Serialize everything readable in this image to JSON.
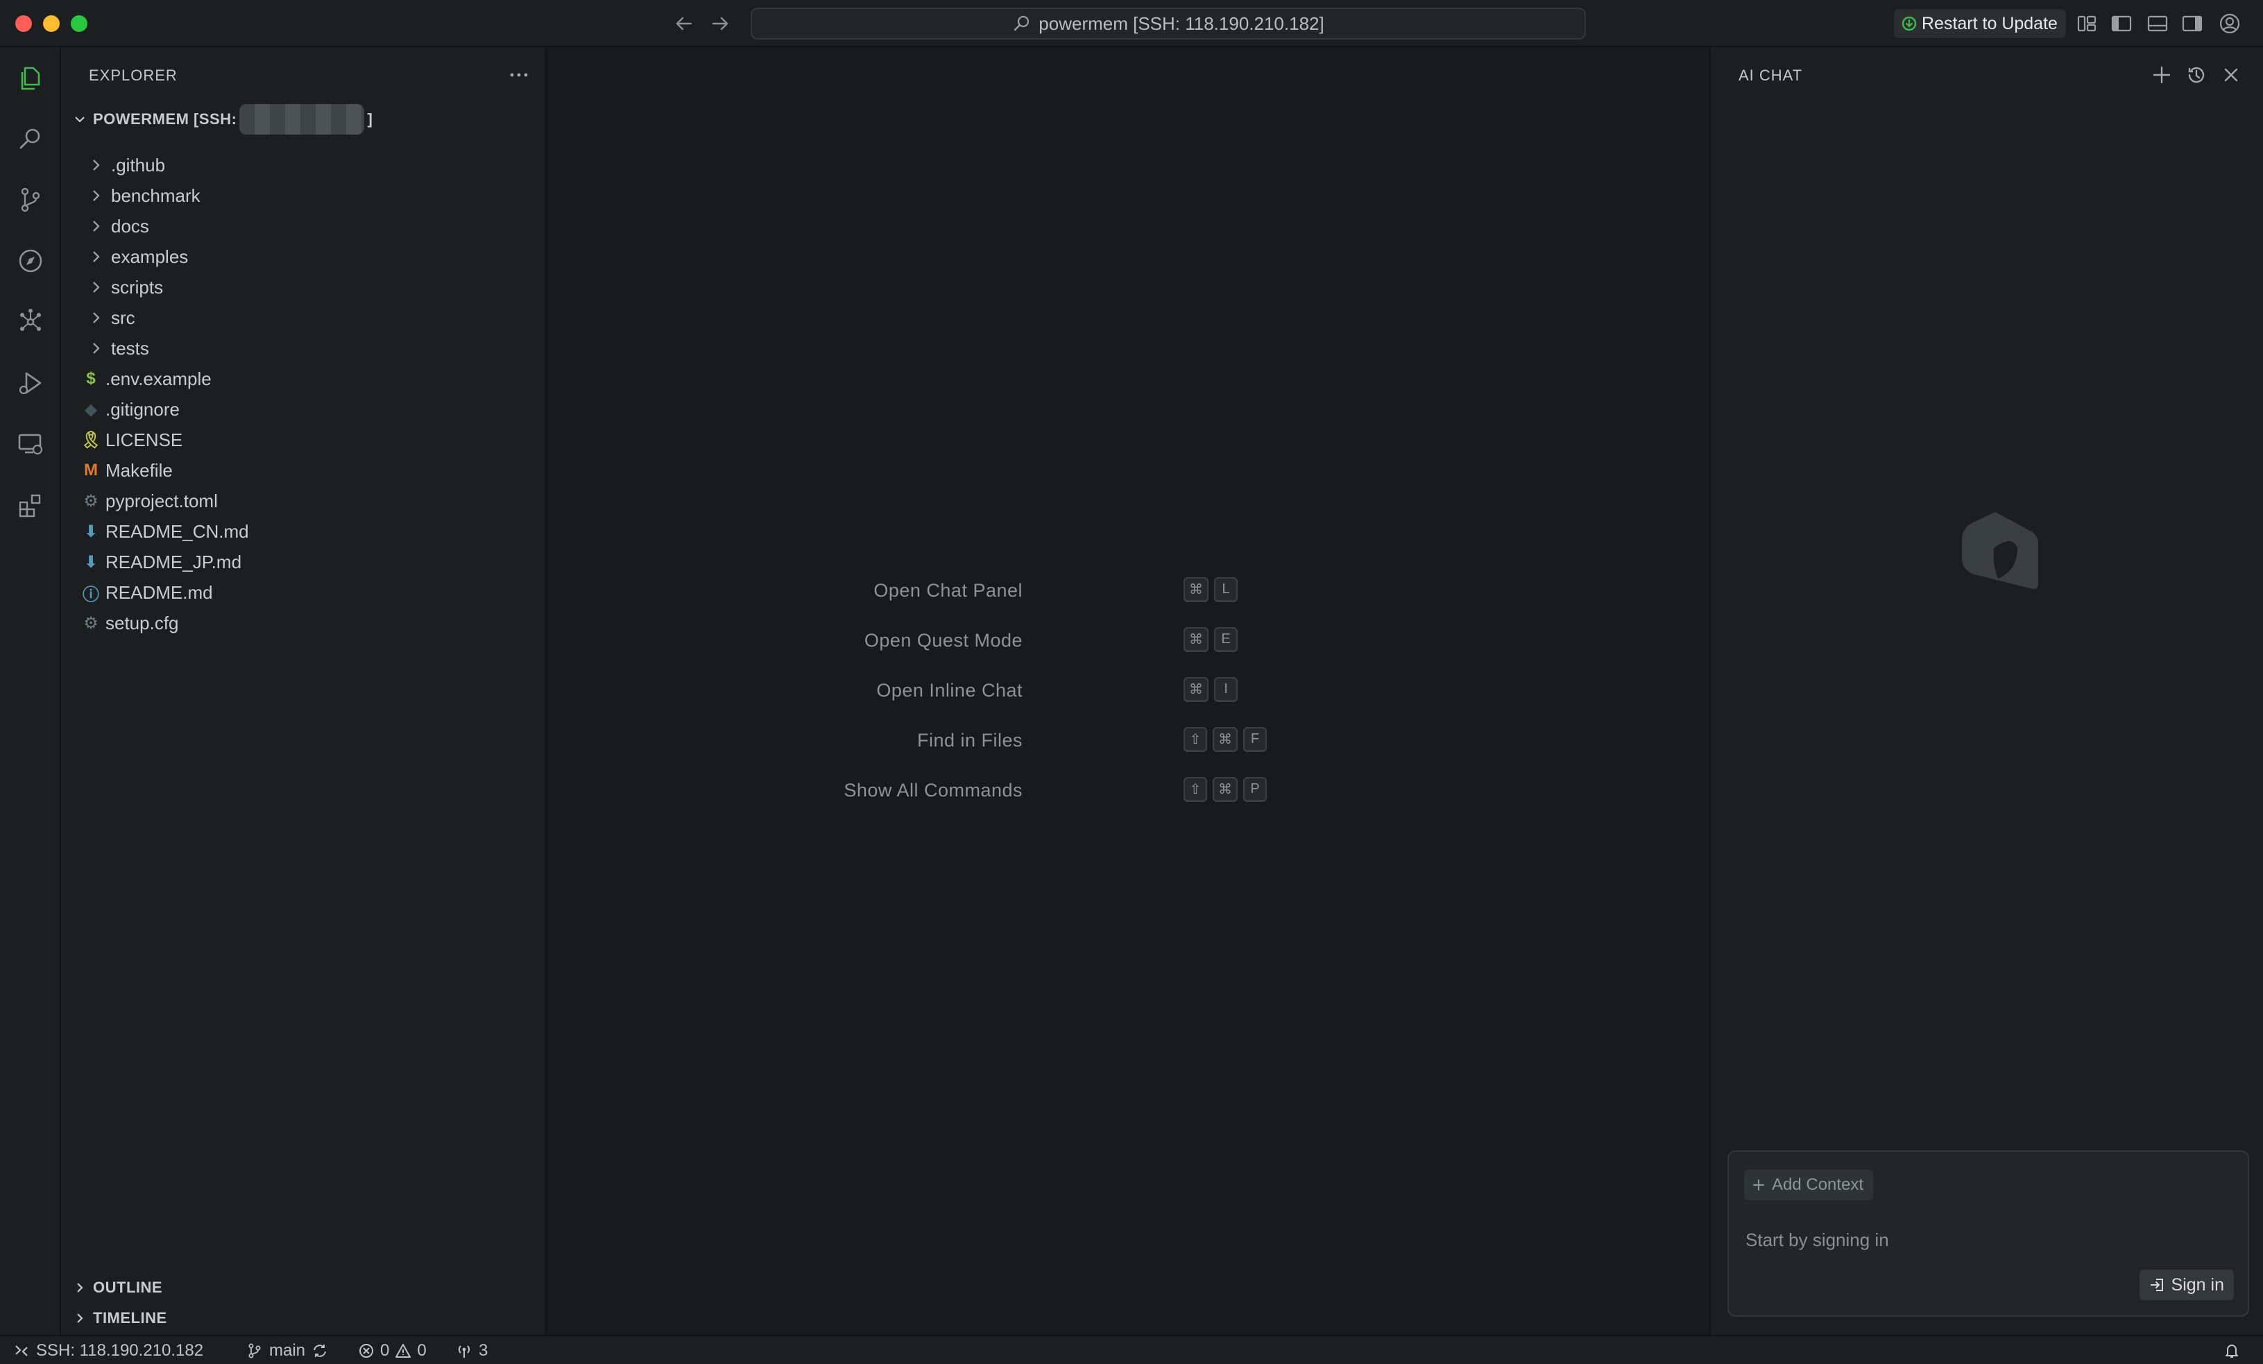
{
  "titlebar": {
    "command_center": "powermem [SSH: 118.190.210.182]",
    "restart_label": "Restart to Update",
    "colors": {
      "close": "#ff5f57",
      "minimize": "#febc2e",
      "maximize": "#28c840"
    }
  },
  "activity": [
    {
      "name": "explorer-icon",
      "active": true
    },
    {
      "name": "search-icon"
    },
    {
      "name": "source-control-icon"
    },
    {
      "name": "compass-icon"
    },
    {
      "name": "graph-icon"
    },
    {
      "name": "run-debug-icon"
    },
    {
      "name": "remote-explorer-icon"
    },
    {
      "name": "extensions-icon"
    }
  ],
  "explorer": {
    "title": "EXPLORER",
    "root_prefix": "POWERMEM [SSH:",
    "root_suffix": "]",
    "folders": [
      ".github",
      "benchmark",
      "docs",
      "examples",
      "scripts",
      "src",
      "tests"
    ],
    "files": [
      {
        "name": ".env.example",
        "icon": "$",
        "color": "#8dc149"
      },
      {
        "name": ".gitignore",
        "icon": "◆",
        "color": "#41535b"
      },
      {
        "name": "LICENSE",
        "icon": "🎗",
        "color": "#cbcb41"
      },
      {
        "name": "Makefile",
        "icon": "M",
        "color": "#e37933"
      },
      {
        "name": "pyproject.toml",
        "icon": "⚙",
        "color": "#6d8086"
      },
      {
        "name": "README_CN.md",
        "icon": "⬇",
        "color": "#519aba"
      },
      {
        "name": "README_JP.md",
        "icon": "⬇",
        "color": "#519aba"
      },
      {
        "name": "README.md",
        "icon": "ⓘ",
        "color": "#519aba"
      },
      {
        "name": "setup.cfg",
        "icon": "⚙",
        "color": "#6d8086"
      }
    ],
    "sections": [
      "OUTLINE",
      "TIMELINE"
    ]
  },
  "editor": {
    "hints": [
      {
        "label": "Open Chat Panel",
        "keys": [
          "⌘",
          "L"
        ]
      },
      {
        "label": "Open Quest Mode",
        "keys": [
          "⌘",
          "E"
        ]
      },
      {
        "label": "Open Inline Chat",
        "keys": [
          "⌘",
          "I"
        ]
      },
      {
        "label": "Find in Files",
        "keys": [
          "⇧",
          "⌘",
          "F"
        ]
      },
      {
        "label": "Show All Commands",
        "keys": [
          "⇧",
          "⌘",
          "P"
        ]
      }
    ]
  },
  "chat": {
    "title": "AI CHAT",
    "add_context": "Add Context",
    "placeholder": "Start by signing in",
    "sign_in": "Sign in"
  },
  "status": {
    "remote": "SSH: 118.190.210.182",
    "branch": "main",
    "errors": "0",
    "warnings": "0",
    "ports": "3"
  }
}
